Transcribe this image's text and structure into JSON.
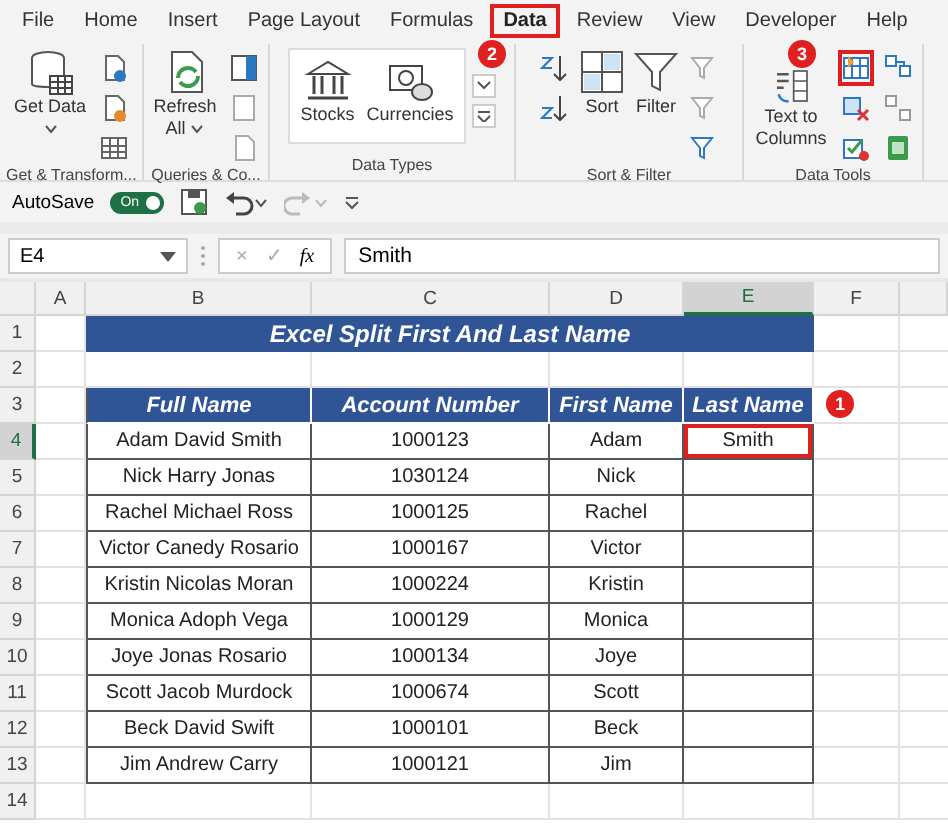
{
  "tabs": [
    {
      "label": "File",
      "selected": false,
      "highlighted": false
    },
    {
      "label": "Home",
      "selected": false,
      "highlighted": false
    },
    {
      "label": "Insert",
      "selected": false,
      "highlighted": false
    },
    {
      "label": "Page Layout",
      "selected": false,
      "highlighted": false
    },
    {
      "label": "Formulas",
      "selected": false,
      "highlighted": false
    },
    {
      "label": "Data",
      "selected": true,
      "highlighted": true
    },
    {
      "label": "Review",
      "selected": false,
      "highlighted": false
    },
    {
      "label": "View",
      "selected": false,
      "highlighted": false
    },
    {
      "label": "Developer",
      "selected": false,
      "highlighted": false
    },
    {
      "label": "Help",
      "selected": false,
      "highlighted": false
    }
  ],
  "ribbon_groups": [
    {
      "label": "Get & Transform...",
      "items": [
        {
          "kind": "big",
          "label": "Get Data",
          "dropdown": true
        },
        {
          "kind": "icon_stack",
          "highlighted": false
        }
      ]
    },
    {
      "label": "Queries & Co...",
      "items": [
        {
          "kind": "big",
          "label": "Refresh All",
          "dropdown": true
        },
        {
          "kind": "icon_stack",
          "highlighted": false
        }
      ]
    },
    {
      "label": "Data Types",
      "items": [
        {
          "kind": "gallery",
          "entries": [
            "Stocks",
            "Currencies"
          ]
        }
      ]
    },
    {
      "label": "Sort & Filter",
      "items": [
        {
          "kind": "icon_stack",
          "highlighted": false
        },
        {
          "kind": "big",
          "label": "Sort",
          "dropdown": false
        },
        {
          "kind": "big",
          "label": "Filter",
          "dropdown": false
        },
        {
          "kind": "icon_stack",
          "highlighted": false
        }
      ]
    },
    {
      "label": "Data Tools",
      "items": [
        {
          "kind": "big",
          "label": "Text to Columns",
          "dropdown": false
        },
        {
          "kind": "icon_stack",
          "highlighted": true
        },
        {
          "kind": "icon_stack",
          "highlighted": false
        }
      ]
    }
  ],
  "quick_access": {
    "autosave_label": "AutoSave",
    "autosave_on": true,
    "toggle_label": "On"
  },
  "formula_bar": {
    "name_box": "E4",
    "cancel": "×",
    "enter": "✓",
    "function_symbol": "fx",
    "value": "Smith"
  },
  "sheet": {
    "columns": [
      {
        "label": "A",
        "selected": false
      },
      {
        "label": "B",
        "selected": false
      },
      {
        "label": "C",
        "selected": false
      },
      {
        "label": "D",
        "selected": false
      },
      {
        "label": "E",
        "selected": true
      },
      {
        "label": "F",
        "selected": false
      }
    ],
    "rows": [
      {
        "number": "1",
        "selected": false,
        "kind": "title",
        "cells": [
          "Excel Split First And Last Name"
        ]
      },
      {
        "number": "2",
        "selected": false,
        "kind": "empty"
      },
      {
        "number": "3",
        "selected": false,
        "kind": "header",
        "cells": [
          "Full Name",
          "Account Number",
          "First Name",
          "Last Name"
        ]
      },
      {
        "number": "4",
        "selected": true,
        "kind": "data",
        "boxed": true,
        "cells": [
          "Adam David Smith",
          "1000123",
          "Adam",
          "Smith"
        ]
      },
      {
        "number": "5",
        "selected": false,
        "kind": "data",
        "boxed": false,
        "cells": [
          "Nick Harry Jonas",
          "1030124",
          "Nick"
        ]
      },
      {
        "number": "6",
        "selected": false,
        "kind": "data",
        "boxed": false,
        "cells": [
          "Rachel Michael Ross",
          "1000125",
          "Rachel"
        ]
      },
      {
        "number": "7",
        "selected": false,
        "kind": "data",
        "boxed": false,
        "cells": [
          "Victor Canedy Rosario",
          "1000167",
          "Victor"
        ]
      },
      {
        "number": "8",
        "selected": false,
        "kind": "data",
        "boxed": false,
        "cells": [
          "Kristin Nicolas Moran",
          "1000224",
          "Kristin"
        ]
      },
      {
        "number": "9",
        "selected": false,
        "kind": "data",
        "boxed": false,
        "cells": [
          "Monica Adoph Vega",
          "1000129",
          "Monica"
        ]
      },
      {
        "number": "10",
        "selected": false,
        "kind": "data",
        "boxed": false,
        "cells": [
          "Joye Jonas Rosario",
          "1000134",
          "Joye"
        ]
      },
      {
        "number": "11",
        "selected": false,
        "kind": "data",
        "boxed": false,
        "cells": [
          "Scott Jacob Murdock",
          "1000674",
          "Scott"
        ]
      },
      {
        "number": "12",
        "selected": false,
        "kind": "data",
        "boxed": false,
        "cells": [
          "Beck David Swift",
          "1000101",
          "Beck"
        ]
      },
      {
        "number": "13",
        "selected": false,
        "kind": "data",
        "boxed": false,
        "cells": [
          "Jim Andrew Carry",
          "1000121",
          "Jim"
        ]
      },
      {
        "number": "14",
        "selected": false,
        "kind": "empty"
      }
    ]
  },
  "callouts": [
    {
      "number": "2"
    },
    {
      "number": "3"
    },
    {
      "number": "1"
    }
  ]
}
